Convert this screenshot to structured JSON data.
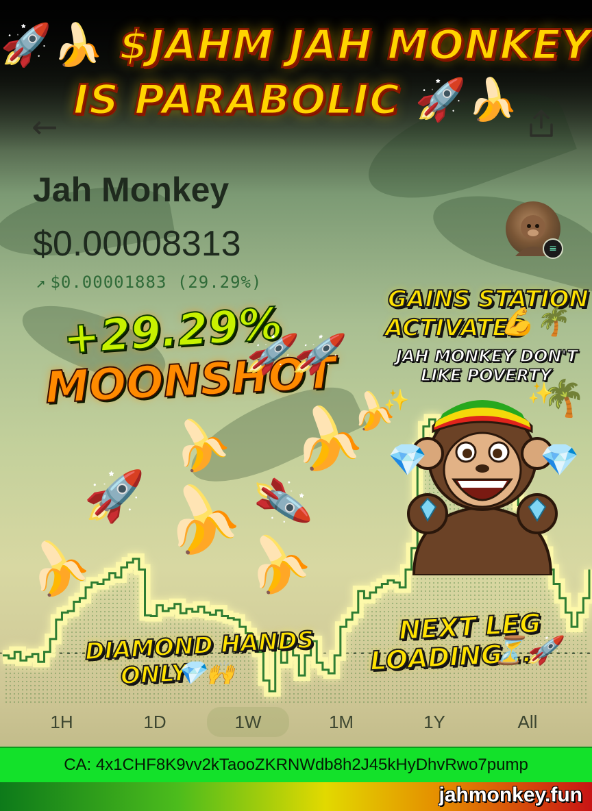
{
  "headline": {
    "line1_emoji_left": "🚀🍌",
    "line1_text": "$JAHM JAH MONKEY",
    "line2_text": "IS PARABOLIC",
    "line2_emoji_right": "🚀🍌"
  },
  "nav": {
    "back_icon": "back-arrow-icon",
    "back_glyph": "←",
    "share_icon": "share-icon"
  },
  "token": {
    "name": "Jah Monkey",
    "price": "$0.00008313",
    "change_arrow": "↗",
    "change_text": "$0.00001883 (29.29%)",
    "badge_glyph": "≡"
  },
  "stickers": {
    "moonshot_pct": "+29.29%",
    "moonshot_word": "MOONSHOT",
    "moonshot_emoji": "🚀🚀",
    "gains_line1": "GAINS STATION",
    "gains_line2": "ACTIVATED",
    "gains_emoji": "💪🌴",
    "poverty_line1": "JAH MONKEY DON'T",
    "poverty_line2": "LIKE POVERTY",
    "diamond_line1": "DIAMOND HANDS",
    "diamond_line2": "ONLY",
    "diamond_emoji": "💎🙌",
    "next_line1": "NEXT LEG",
    "next_line2": "LOADING...",
    "next_emoji": "⏳🚀"
  },
  "decorations": {
    "banana": "🍌",
    "rocket": "🚀",
    "diamond": "💎",
    "palm": "🌴",
    "sparkle": "✨"
  },
  "range_tabs": [
    {
      "label": "1H",
      "active": false
    },
    {
      "label": "1D",
      "active": false
    },
    {
      "label": "1W",
      "active": true
    },
    {
      "label": "1M",
      "active": false
    },
    {
      "label": "1Y",
      "active": false
    },
    {
      "label": "All",
      "active": false
    }
  ],
  "contract": {
    "text": "CA: 4x1CHF8K9vv2kTaooZKRNWdb8h2J45kHyDhvRwo7pump"
  },
  "site": {
    "url": "jahmonkey.fun"
  },
  "colors": {
    "line": "#2e7d32",
    "fill": "rgba(60,140,60,0.25)",
    "ca_bar": "#13e12a"
  },
  "chart_data": {
    "type": "line",
    "title": "",
    "xlabel": "",
    "ylabel": "",
    "baseline": 6.43e-05,
    "x": [
      0,
      1,
      2,
      3,
      4,
      5,
      6,
      7,
      8,
      9,
      10,
      11,
      12,
      13,
      14,
      15,
      16,
      17,
      18,
      19,
      20,
      21,
      22,
      23,
      24,
      25,
      26,
      27,
      28,
      29,
      30,
      31,
      32,
      33,
      34,
      35,
      36,
      37,
      38,
      39,
      40,
      41,
      42,
      43,
      44,
      45,
      46,
      47,
      48,
      49,
      50,
      51,
      52,
      53,
      54,
      55,
      56,
      57,
      58,
      59,
      60,
      61,
      62,
      63,
      64,
      65,
      66,
      67,
      68,
      69,
      70,
      71,
      72,
      73,
      74,
      75,
      76,
      77,
      78,
      79,
      80,
      81,
      82,
      83,
      84,
      85,
      86,
      87,
      88,
      89,
      90,
      91,
      92,
      93,
      94,
      95,
      96,
      97,
      98,
      99
    ],
    "y": [
      6.4e-05,
      6.36e-05,
      6.45e-05,
      6.33e-05,
      6.38e-05,
      6.42e-05,
      6.31e-05,
      6.45e-05,
      6.63e-05,
      6.9e-05,
      7e-05,
      7.02e-05,
      7.15e-05,
      7.2e-05,
      7.35e-05,
      7.42e-05,
      7.4e-05,
      7.46e-05,
      7.55e-05,
      7.49e-05,
      7.63e-05,
      7.7e-05,
      7.75e-05,
      7.6e-05,
      6.96e-05,
      6.95e-05,
      7.1e-05,
      7.02e-05,
      7.06e-05,
      7.12e-05,
      6.99e-05,
      7.05e-05,
      7.01e-05,
      7.08e-05,
      7e-05,
      6.97e-05,
      7.03e-05,
      6.95e-05,
      6.92e-05,
      6.9e-05,
      6.8e-05,
      6.71e-05,
      6.6e-05,
      6.45e-05,
      6.05e-05,
      5.9e-05,
      6.5e-05,
      6.3e-05,
      6.6e-05,
      6.4e-05,
      6.12e-05,
      6.4e-05,
      6.6e-05,
      6.3e-05,
      6.2e-05,
      6.15e-05,
      6.4e-05,
      6.8e-05,
      6.9e-05,
      7e-05,
      7.3e-05,
      7.2e-05,
      7.28e-05,
      7.35e-05,
      7.4e-05,
      7.45e-05,
      7.42e-05,
      7.35e-05,
      7.6e-05,
      7.9e-05,
      9.3e-05,
      9.6e-05,
      9.7e-05,
      9.45e-05,
      9.5e-05,
      9.35e-05,
      9.3e-05,
      9.5e-05,
      9.46e-05,
      9.4e-05,
      9.5e-05,
      9.44e-05,
      9.48e-05,
      9.45e-05,
      9.3e-05,
      9.2e-05,
      8.8e-05,
      8.5e-05,
      8.45e-05,
      8.3e-05,
      8e-05,
      7.85e-05,
      7.6e-05,
      7.4e-05,
      7.2e-05,
      7e-05,
      6.8e-05,
      7e-05,
      7.2e-05,
      7.6e-05
    ],
    "ylim": [
      5.7e-05,
      0.000102
    ],
    "grid": false
  }
}
